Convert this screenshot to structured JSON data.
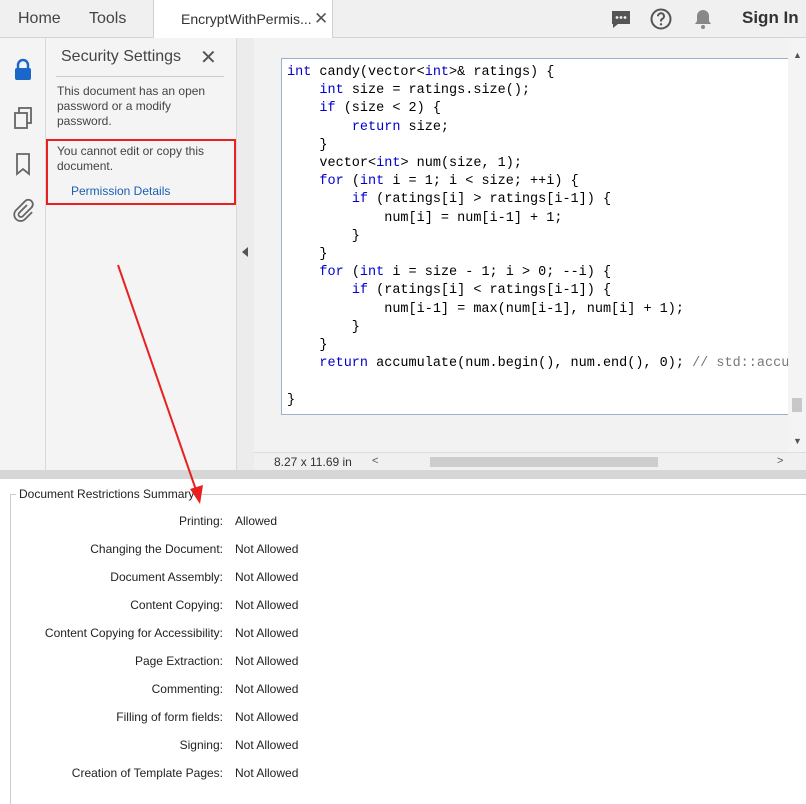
{
  "topbar": {
    "home_tab": "Home",
    "tools_tab": "Tools",
    "document_tab": "EncryptWithPermis...",
    "close_tab_glyph": "✕",
    "sign_in": "Sign In",
    "icons": [
      "chat-icon",
      "help-icon",
      "bell-icon"
    ]
  },
  "rail": {
    "icons": [
      "lock-icon",
      "pages-icon",
      "bookmark-icon",
      "attachment-icon"
    ],
    "active_color": "#1a66c9"
  },
  "security_panel": {
    "title": "Security Settings",
    "close_glyph": "✕",
    "password_note": [
      "This document has an open",
      "password or a modify",
      "password."
    ],
    "restriction_note": [
      "You cannot edit or copy this",
      "document."
    ],
    "permission_link": "Permission Details",
    "highlight_color": "#e82020"
  },
  "document": {
    "code_lines": [
      [
        {
          "t": "int",
          "k": "kw"
        },
        {
          "t": " candy(vector<"
        },
        {
          "t": "int",
          "k": "kw"
        },
        {
          "t": ">& ratings) {"
        }
      ],
      [
        {
          "t": "    "
        },
        {
          "t": "int",
          "k": "kw"
        },
        {
          "t": " size = ratings.size();"
        }
      ],
      [
        {
          "t": "    "
        },
        {
          "t": "if",
          "k": "kw"
        },
        {
          "t": " (size < 2) {"
        }
      ],
      [
        {
          "t": "        "
        },
        {
          "t": "return",
          "k": "kw"
        },
        {
          "t": " size;"
        }
      ],
      [
        {
          "t": "    }"
        }
      ],
      [
        {
          "t": "    vector<"
        },
        {
          "t": "int",
          "k": "kw"
        },
        {
          "t": "> num(size, 1);"
        }
      ],
      [
        {
          "t": "    "
        },
        {
          "t": "for",
          "k": "kw"
        },
        {
          "t": " ("
        },
        {
          "t": "int",
          "k": "kw"
        },
        {
          "t": " i = 1; i < size; ++i) {"
        }
      ],
      [
        {
          "t": "        "
        },
        {
          "t": "if",
          "k": "kw"
        },
        {
          "t": " (ratings[i] > ratings[i-1]) {"
        }
      ],
      [
        {
          "t": "            num[i] = num[i-1] + 1;"
        }
      ],
      [
        {
          "t": "        }"
        }
      ],
      [
        {
          "t": "    }"
        }
      ],
      [
        {
          "t": "    "
        },
        {
          "t": "for",
          "k": "kw"
        },
        {
          "t": " ("
        },
        {
          "t": "int",
          "k": "kw"
        },
        {
          "t": " i = size - 1; i > 0; --i) {"
        }
      ],
      [
        {
          "t": "        "
        },
        {
          "t": "if",
          "k": "kw"
        },
        {
          "t": " (ratings[i] < ratings[i-1]) {"
        }
      ],
      [
        {
          "t": "            num[i-1] = max(num[i-1], num[i] + 1);"
        }
      ],
      [
        {
          "t": "        }"
        }
      ],
      [
        {
          "t": "    }"
        }
      ],
      [
        {
          "t": "    "
        },
        {
          "t": "return",
          "k": "kw"
        },
        {
          "t": " accumulate(num.begin(), num.end(), 0); "
        },
        {
          "t": "// std::accumu",
          "k": "cm"
        }
      ],
      [
        {
          "t": ""
        }
      ],
      [
        {
          "t": "}"
        }
      ]
    ],
    "page_size": "8.27 x 11.69 in"
  },
  "summary": {
    "title": "Document Restrictions Summary",
    "rows": [
      {
        "label": "Printing:",
        "value": "Allowed"
      },
      {
        "label": "Changing the Document:",
        "value": "Not Allowed"
      },
      {
        "label": "Document Assembly:",
        "value": "Not Allowed"
      },
      {
        "label": "Content Copying:",
        "value": "Not Allowed"
      },
      {
        "label": "Content Copying for Accessibility:",
        "value": "Not Allowed"
      },
      {
        "label": "Page Extraction:",
        "value": "Not Allowed"
      },
      {
        "label": "Commenting:",
        "value": "Not Allowed"
      },
      {
        "label": "Filling of form fields:",
        "value": "Not Allowed"
      },
      {
        "label": "Signing:",
        "value": "Not Allowed"
      },
      {
        "label": "Creation of Template Pages:",
        "value": "Not Allowed"
      }
    ]
  },
  "annotation": {
    "arrow_color": "#e82020"
  }
}
